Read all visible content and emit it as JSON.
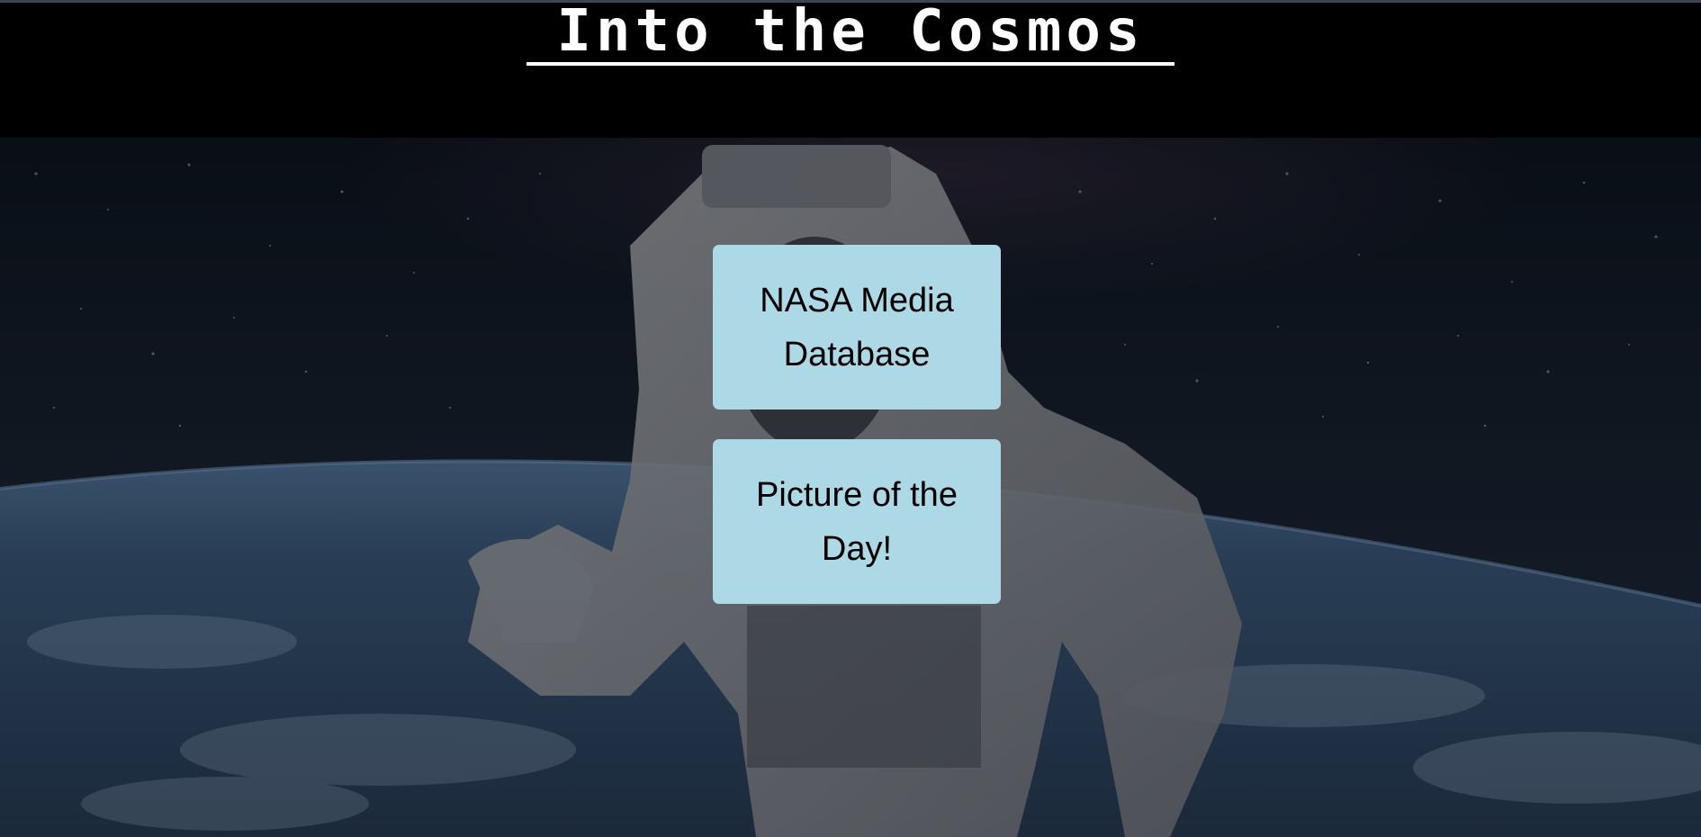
{
  "header": {
    "title": "Into the Cosmos"
  },
  "nav": {
    "media_database_label": "NASA Media Database",
    "picture_of_day_label": "Picture of the Day!"
  },
  "colors": {
    "header_background": "#000000",
    "button_background": "#add8e6",
    "button_text": "#000000",
    "title_text": "#ffffff"
  }
}
